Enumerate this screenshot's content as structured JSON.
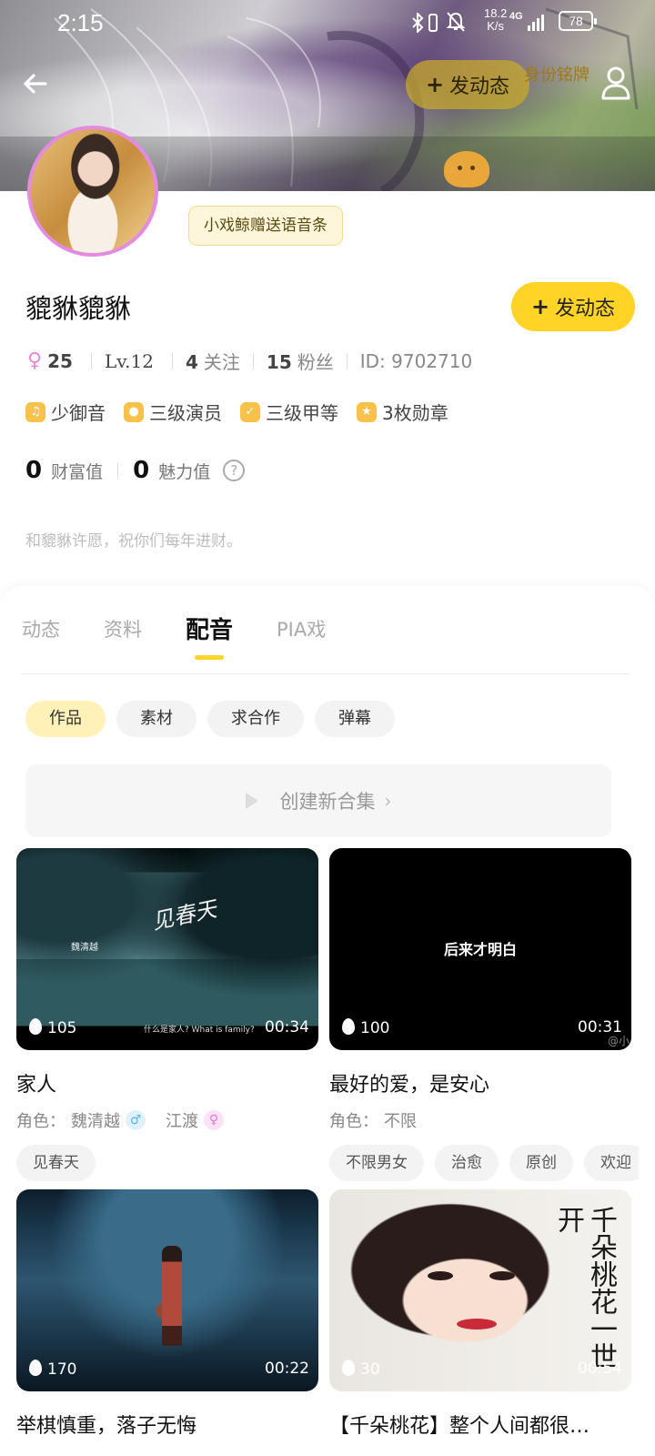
{
  "status_bar": {
    "time": "2:15",
    "net_speed": "18.2",
    "net_unit": "K/s",
    "network_type": "4G",
    "battery": "78",
    "icons": [
      "bluetooth-icon",
      "vibrate-icon",
      "mute-icon",
      "signal-icon",
      "battery-icon"
    ]
  },
  "header": {
    "post_label": "发动态",
    "identity_label": "身份铭牌"
  },
  "profile": {
    "speech_bubble": "小戏鲸赠送语音条",
    "nickname": "貔貅貔貅",
    "post_button": "发动态",
    "age": "25",
    "level": "Lv.12",
    "following_count": "4",
    "following_label": "关注",
    "fans_count": "15",
    "fans_label": "粉丝",
    "id_text": "ID: 9702710",
    "badges": [
      "少御音",
      "三级演员",
      "三级甲等",
      "3枚勋章"
    ],
    "wealth_value": "0",
    "wealth_label": "财富值",
    "charm_value": "0",
    "charm_label": "魅力值",
    "signature": "和貔貅许愿，祝你们每年进财。"
  },
  "tabs": [
    "动态",
    "资料",
    "配音",
    "PIA戏"
  ],
  "active_tab": "配音",
  "sub_tabs": [
    "作品",
    "素材",
    "求合作",
    "弹幕"
  ],
  "create_collection": "创建新合集",
  "cards": [
    {
      "title": "家人",
      "heat": "105",
      "duration": "00:34",
      "role_label": "角色：",
      "roles": [
        "魏清越",
        "江渡"
      ],
      "tags": [
        "见春天"
      ],
      "thumb_text": "魏清越",
      "thumb_subtitle": "什么是家人? What is family?"
    },
    {
      "title": "最好的爱，是安心",
      "heat": "100",
      "duration": "00:31",
      "role_label": "角色：",
      "roles": [
        "不限"
      ],
      "tags": [
        "不限男女",
        "治愈",
        "原创",
        "欢迎"
      ],
      "thumb_text": "后来才明白",
      "thumb_watermark": "@小"
    },
    {
      "title": "举棋慎重，落子无悔",
      "heat": "170",
      "duration": "00:22"
    },
    {
      "title": "【千朵桃花】整个人间都很…",
      "heat": "30",
      "duration": "00:54"
    }
  ],
  "colors": {
    "accent": "#ffd426",
    "female": "#e68ad8",
    "male": "#58b8e5"
  }
}
